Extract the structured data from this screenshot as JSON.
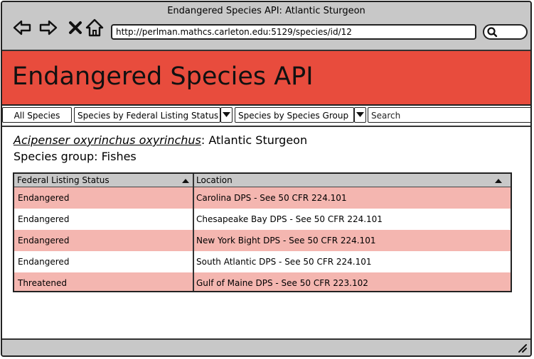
{
  "window": {
    "title": "Endangered Species API: Atlantic Sturgeon"
  },
  "browser": {
    "url": "http://perlman.mathcs.carleton.edu:5129/species/id/12",
    "nav_icons": [
      "back-arrow-icon",
      "forward-arrow-icon",
      "close-x-icon",
      "home-icon",
      "search-icon"
    ]
  },
  "banner": {
    "title": "Endangered Species API",
    "color": "#e84c3d"
  },
  "tabs": {
    "all_species": "All Species",
    "by_status": "Species by Federal Listing Status",
    "by_group": "Species by Species Group",
    "search_placeholder": "Search"
  },
  "species": {
    "scientific_name": "Acipenser oxyrinchus oxyrinchus",
    "separator": ":",
    "common_name": "Atlantic Sturgeon",
    "group_label": "Species group:",
    "group_value": "Fishes"
  },
  "table": {
    "columns": [
      "Federal Listing Status",
      "Location"
    ],
    "rows": [
      {
        "status": "Endangered",
        "location": "Carolina DPS - See 50 CFR 224.101"
      },
      {
        "status": "Endangered",
        "location": "Chesapeake Bay DPS - See 50 CFR 224.101"
      },
      {
        "status": "Endangered",
        "location": "New York Bight DPS - See 50 CFR 224.101"
      },
      {
        "status": "Endangered",
        "location": "South Atlantic DPS - See 50 CFR 224.101"
      },
      {
        "status": "Threatened",
        "location": "Gulf of Maine DPS - See 50 CFR 223.102"
      }
    ],
    "stripe_color": "#f4b6b0"
  }
}
